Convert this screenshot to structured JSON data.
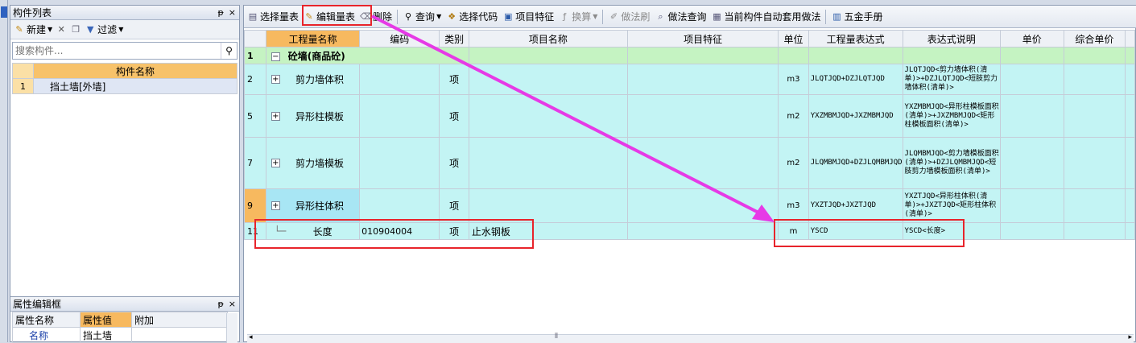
{
  "left_panel": {
    "title": "构件列表",
    "pin_label": "ᵖ",
    "close_label": "×",
    "toolbar": {
      "new_label": "新建",
      "filter_label": "过滤"
    },
    "search_placeholder": "搜索构件...",
    "table_header": "构件名称",
    "rows": [
      {
        "num": "1",
        "name": "挡土墙[外墙]"
      }
    ]
  },
  "prop_panel": {
    "title": "属性编辑框",
    "headers": [
      "属性名称",
      "属性值",
      "附加"
    ],
    "rows": [
      {
        "name": "名称",
        "value": "挡土墙",
        "extra": ""
      }
    ]
  },
  "main_toolbar": {
    "items": [
      {
        "label": "选择量表",
        "icon": "select-table-icon",
        "enabled": true
      },
      {
        "label": "编辑量表",
        "icon": "edit-table-icon",
        "enabled": true
      },
      {
        "label": "删除",
        "icon": "delete-icon",
        "enabled": true
      },
      {
        "label": "查询",
        "icon": "search-icon",
        "enabled": true,
        "dropdown": true
      },
      {
        "label": "选择代码",
        "icon": "select-code-icon",
        "enabled": true
      },
      {
        "label": "项目特征",
        "icon": "feature-icon",
        "enabled": true
      },
      {
        "label": "换算",
        "icon": "convert-icon",
        "enabled": false,
        "dropdown": true
      },
      {
        "label": "做法刷",
        "icon": "brush-icon",
        "enabled": false
      },
      {
        "label": "做法查询",
        "icon": "method-query-icon",
        "enabled": true
      },
      {
        "label": "当前构件自动套用做法",
        "icon": "auto-apply-icon",
        "enabled": true
      },
      {
        "label": "五金手册",
        "icon": "manual-icon",
        "enabled": true
      }
    ]
  },
  "grid": {
    "headers": [
      "工程量名称",
      "编码",
      "类别",
      "项目名称",
      "项目特征",
      "单位",
      "工程量表达式",
      "表达式说明",
      "单价",
      "综合单价"
    ],
    "rows": [
      {
        "num": "1",
        "type": "group",
        "expander": "−",
        "name": "砼墙(商品砼)",
        "code": "",
        "cat": "",
        "proj": "",
        "feat": "",
        "unit": "",
        "expr": "",
        "desc": ""
      },
      {
        "num": "2",
        "type": "item",
        "expander": "+",
        "name": "剪力墙体积",
        "code": "",
        "cat": "项",
        "proj": "",
        "feat": "",
        "unit": "m3",
        "expr": "JLQTJQD+DZJLQTJQD",
        "desc": "JLQTJQD<剪力墙体积(清单)>+DZJLQTJQD<短肢剪力墙体积(清单)>"
      },
      {
        "num": "5",
        "type": "item",
        "expander": "+",
        "name": "异形柱模板",
        "code": "",
        "cat": "项",
        "proj": "",
        "feat": "",
        "unit": "m2",
        "expr": "YXZMBMJQD+JXZMBMJQD",
        "desc": "YXZMBMJQD<异形柱模板面积(清单)>+JXZMBMJQD<矩形柱模板面积(清单)>"
      },
      {
        "num": "7",
        "type": "item",
        "expander": "+",
        "name": "剪力墙模板",
        "code": "",
        "cat": "项",
        "proj": "",
        "feat": "",
        "unit": "m2",
        "expr": "JLQMBMJQD+DZJLQMBMJQD",
        "desc": "JLQMBMJQD<剪力墙模板面积(清单)>+DZJLQMBMJQD<短肢剪力墙模板面积(清单)>"
      },
      {
        "num": "9",
        "type": "item",
        "expander": "+",
        "name": "异形柱体积",
        "code": "",
        "cat": "项",
        "proj": "",
        "feat": "",
        "unit": "m3",
        "expr": "YXZTJQD+JXZTJQD",
        "desc": "YXZTJQD<异形柱体积(清单)>+JXZTJQD<矩形柱体积(清单)>"
      },
      {
        "num": "11",
        "type": "item",
        "expander": "",
        "name": "长度",
        "code": "010904004",
        "cat": "项",
        "proj": "止水钢板",
        "feat": "",
        "unit": "m",
        "expr": "YSCD",
        "desc": "YSCD<长度>"
      }
    ]
  },
  "colors": {
    "group_row": "#c5f3c2",
    "item_row": "#c3f4f4",
    "header_highlight": "#f7b95f",
    "annotation_red": "#e8242b",
    "arrow_magenta": "#e63ae6"
  }
}
